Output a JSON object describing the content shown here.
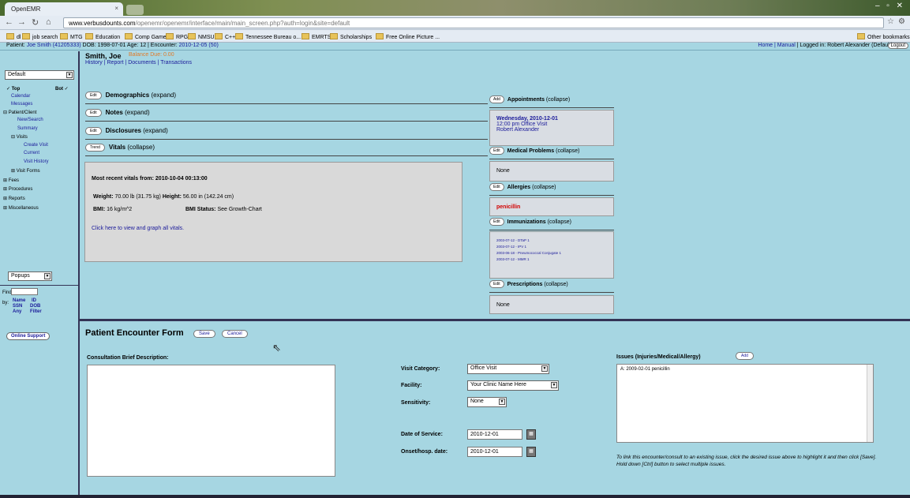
{
  "browser": {
    "tab_title": "OpenEMR",
    "url_domain": "www.verbusdounts.com",
    "url_path": "/openemr/openemr/interface/main/main_screen.php?auth=login&site=default",
    "bookmarks": [
      "dl",
      "job search",
      "MTG",
      "Education",
      "Comp Game",
      "RPG",
      "NMSU",
      "C++",
      "Tennessee Bureau o...",
      "EMRTS",
      "Scholarships",
      "Free Online Picture ..."
    ],
    "other_bookmarks": "Other bookmarks"
  },
  "titlebar": {
    "patient_label": "Patient:",
    "patient_name": "Joe Smith (41205333)",
    "dob_text": "DOB: 1998-07-01 Age: 12 | Encounter:",
    "encounter": "2010-12-05 (50)",
    "home": "Home",
    "manual": "Manual",
    "logged_in": "| Logged in: Robert Alexander (Default)",
    "logout": "Logout"
  },
  "leftnav": {
    "default_select": "Default",
    "top": "Top",
    "bot": "Bot",
    "items": [
      "Calendar",
      "Messages",
      "Patient/Client",
      "New/Search",
      "Summary",
      "Visits",
      "Create Visit",
      "Current",
      "Visit History",
      "Visit Forms",
      "Fees",
      "Procedures",
      "Reports",
      "Miscellaneous"
    ],
    "popups_select": "Popups",
    "find_label": "Find",
    "by_label": "by:",
    "find_opts": [
      "Name",
      "ID",
      "SSN",
      "DOB",
      "Any",
      "Filter"
    ],
    "online_support": "Online Support"
  },
  "patient": {
    "name": "Smith, Joe",
    "balance": "Balance Due: 0.00",
    "tabs": [
      "History",
      "Report",
      "Documents",
      "Transactions"
    ]
  },
  "sections": [
    {
      "btn": "Edit",
      "title": "Demographics",
      "state": "(expand)"
    },
    {
      "btn": "Edit",
      "title": "Notes",
      "state": "(expand)"
    },
    {
      "btn": "Edit",
      "title": "Disclosures",
      "state": "(expand)"
    },
    {
      "btn": "Trend",
      "title": "Vitals",
      "state": "(collapse)"
    }
  ],
  "vitals": {
    "recent": "Most recent vitals from: 2010-10-04 00:13:00",
    "weight_label": "Weight:",
    "weight": "70.00 lb (31.75 kg)",
    "height_label": "Height:",
    "height": "56.00 in (142.24 cm)",
    "bmi_label": "BMI:",
    "bmi": "16 kg/m^2",
    "bmi_status_label": "BMI Status:",
    "bmi_status": "See Growth-Chart",
    "graph_link": "Click here to view and graph all vitals."
  },
  "right": {
    "appointments": {
      "btn": "Add",
      "title": "Appointments",
      "state": "(collapse)",
      "date": "Wednesday, 2010-12-01",
      "time": "12:00 pm Office Visit",
      "provider": "Robert Alexander"
    },
    "medical_problems": {
      "btn": "Edit",
      "title": "Medical Problems",
      "state": "(collapse)",
      "value": "None"
    },
    "allergies": {
      "btn": "Edit",
      "title": "Allergies",
      "state": "(collapse)",
      "value": "penicillin"
    },
    "immunizations": {
      "btn": "Edit",
      "title": "Immunizations",
      "state": "(collapse)",
      "items": [
        "2003-07-12 - DTaP 1",
        "2003-07-12 - IPV 1",
        "2003-06-18 - Pneumococcal Conjugate 1",
        "2003-07-12 - MMR 1"
      ]
    },
    "prescriptions": {
      "btn": "Edit",
      "title": "Prescriptions",
      "state": "(collapse)",
      "value": "None"
    }
  },
  "form": {
    "title": "Patient Encounter Form",
    "save": "Save",
    "cancel": "Cancel",
    "desc_label": "Consultation Brief Description:",
    "visit_category_label": "Visit Category:",
    "visit_category": "Office Visit",
    "facility_label": "Facility:",
    "facility": "Your Clinic Name Here",
    "sensitivity_label": "Sensitivity:",
    "sensitivity": "None",
    "dos_label": "Date of Service:",
    "dos": "2010-12-01",
    "onset_label": "Onset/hosp. date:",
    "onset": "2010-12-01",
    "issues_label": "Issues (Injuries/Medical/Allergy)",
    "issues_add": "Add",
    "issues_item": "A: 2009-02-01 penicillin",
    "issues_help": "To link this encounter/consult to an existing issue, click the desired issue above to highlight it and then click [Save]. Hold down [Ctrl] button to select multiple issues."
  }
}
